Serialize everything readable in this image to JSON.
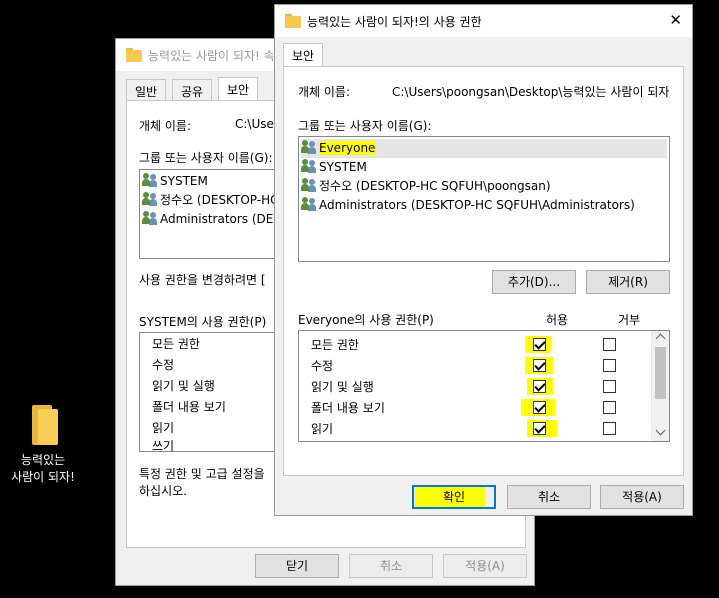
{
  "desktop": {
    "folder_label_line1": "능력있는",
    "folder_label_line2": "사람이 되자!"
  },
  "back_window": {
    "title": "능력있는 사람이 되자! 속",
    "tabs": [
      "일반",
      "공유",
      "보안"
    ],
    "object_name_label": "개체 이름:",
    "object_name_value": "C:\\Use",
    "group_label": "그룹 또는 사용자 이름(G):",
    "users": [
      "SYSTEM",
      "정수오 (DESKTOP-HC",
      "Administrators (DES"
    ],
    "change_text": "사용 권한을 변경하려면 [",
    "perm_label": "SYSTEM의 사용 권한(P)",
    "perms": [
      "모든 권한",
      "수정",
      "읽기 및 실행",
      "폴더 내용 보기",
      "읽기",
      "쓰기"
    ],
    "adv_text_line1": "특정 권한 및 고급 설정을",
    "adv_text_line2": "하십시오.",
    "ok": "닫기",
    "cancel": "취소",
    "apply": "적용(A)"
  },
  "front_window": {
    "title": "능력있는 사람이 되자!의 사용 권한",
    "close_glyph": "✕",
    "tab": "보안",
    "object_name_label": "개체 이름:",
    "object_name_value": "C:\\Users\\poongsan\\Desktop\\능력있는 사람이 되자",
    "group_label": "그룹 또는 사용자 이름(G):",
    "users": [
      "Everyone",
      "SYSTEM",
      "정수오 (DESKTOP-HC SQFUH\\poongsan)",
      "Administrators (DESKTOP-HC SQFUH\\Administrators)"
    ],
    "add_button": "추가(D)...",
    "remove_button": "제거(R)",
    "perm_label": "Everyone의 사용 권한(P)",
    "allow_header": "허용",
    "deny_header": "거부",
    "perms": [
      {
        "name": "모든 권한",
        "allow": true,
        "deny": false
      },
      {
        "name": "수정",
        "allow": true,
        "deny": false
      },
      {
        "name": "읽기 및 실행",
        "allow": true,
        "deny": false
      },
      {
        "name": "폴더 내용 보기",
        "allow": true,
        "deny": false
      },
      {
        "name": "읽기",
        "allow": true,
        "deny": false
      }
    ],
    "ok": "확인",
    "cancel": "취소",
    "apply": "적용(A)"
  },
  "colors": {
    "highlight": "#ffff00",
    "accent": "#0078d7"
  }
}
